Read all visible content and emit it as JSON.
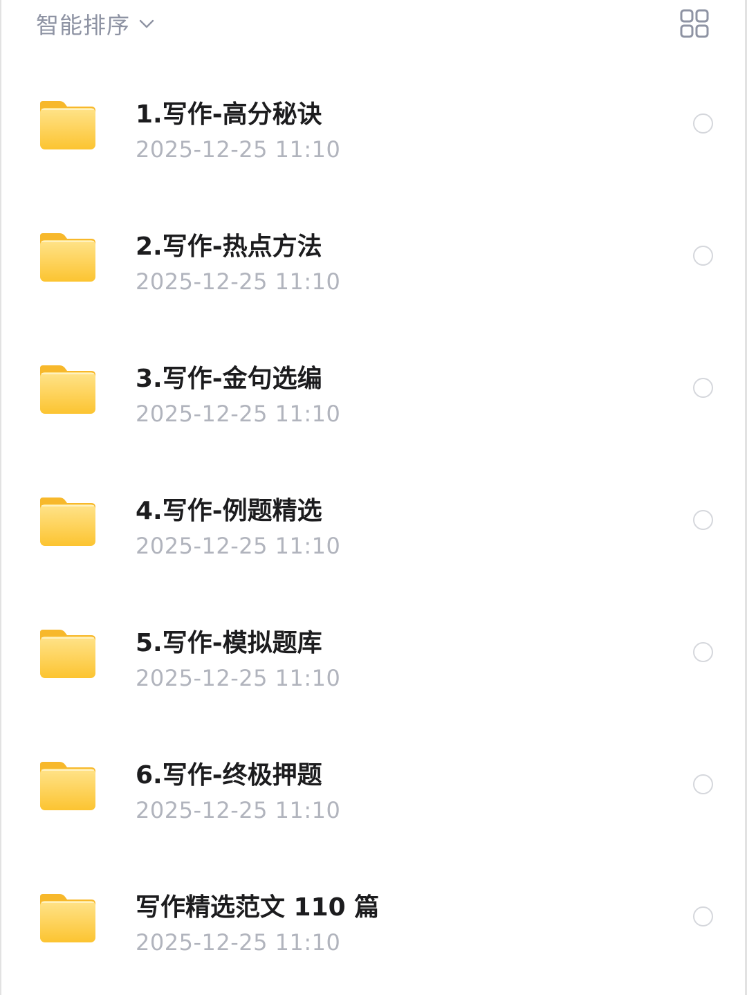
{
  "toolbar": {
    "sort_label": "智能排序",
    "sort_icon": "chevron-down-icon",
    "view_icon": "grid-view-icon"
  },
  "colors": {
    "folder_top": "#FFE38A",
    "folder_bottom": "#FCC431",
    "title": "#1C1C1E",
    "date": "#B1B4BD",
    "muted": "#8E93A3"
  },
  "folders": [
    {
      "name": "1.写作-高分秘诀",
      "date": "2025-12-25 11:10"
    },
    {
      "name": "2.写作-热点方法",
      "date": "2025-12-25 11:10"
    },
    {
      "name": "3.写作-金句选编",
      "date": "2025-12-25 11:10"
    },
    {
      "name": "4.写作-例题精选",
      "date": "2025-12-25 11:10"
    },
    {
      "name": "5.写作-模拟题库",
      "date": "2025-12-25 11:10"
    },
    {
      "name": "6.写作-终极押题",
      "date": "2025-12-25 11:10"
    },
    {
      "name": "写作精选范文 110 篇",
      "date": "2025-12-25 11:10"
    }
  ]
}
